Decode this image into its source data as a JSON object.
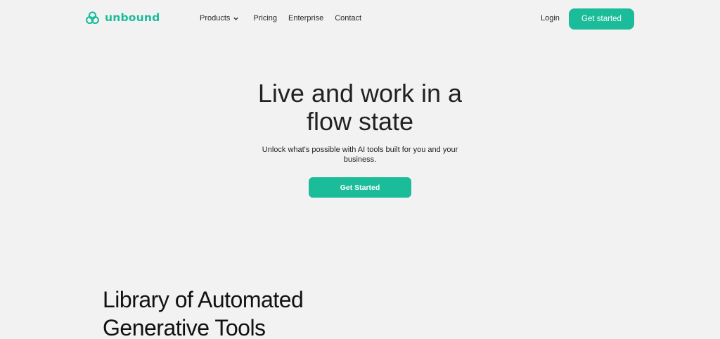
{
  "brand": {
    "name": "unbound",
    "color": "#1bbc99",
    "icon": "unbound-logo-icon"
  },
  "nav": {
    "items": [
      {
        "label": "Products",
        "has_dropdown": true,
        "icon": "chevron-down-icon"
      },
      {
        "label": "Pricing"
      },
      {
        "label": "Enterprise"
      },
      {
        "label": "Contact"
      }
    ],
    "login_label": "Login",
    "cta_label": "Get started"
  },
  "hero": {
    "title_line1": "Live and work in a",
    "title_line2": "flow state",
    "subtitle_line1": "Unlock what's possible with AI tools built for you and your",
    "subtitle_line2": "business.",
    "cta_label": "Get Started"
  },
  "library": {
    "title_line1": "Library of Automated",
    "title_line2": "Generative Tools"
  },
  "colors": {
    "background": "#f2f2f2",
    "accent": "#1bbc99",
    "text": "#222222"
  }
}
